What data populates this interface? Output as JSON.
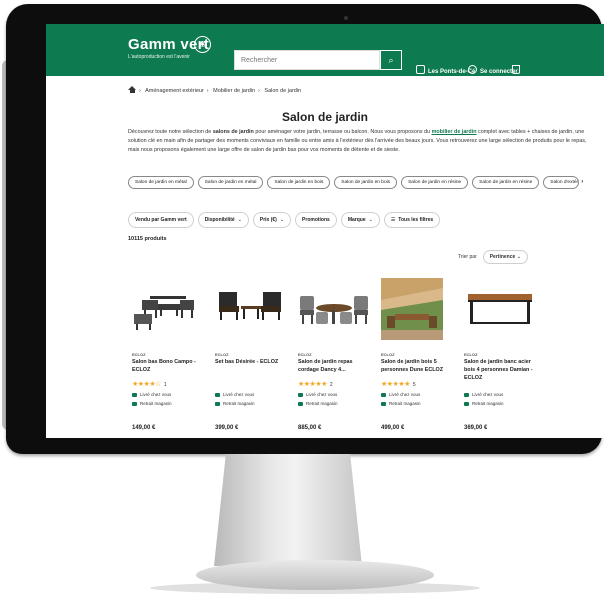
{
  "header": {
    "logo": "Gamm vert",
    "tagline": "L'autoproduction est l'avenir",
    "search_placeholder": "Rechercher",
    "store_label": "Les Ponts-de-Cé",
    "login_label": "Se connecter"
  },
  "breadcrumb": [
    "Aménagement extérieur",
    "Mobilier de jardin",
    "Salon de jardin"
  ],
  "page_title": "Salon de jardin",
  "intro": {
    "part1": "Découvrez toute notre sélection de ",
    "bold1": "salons de jardin",
    "part2": " pour aménager votre jardin, terrasse ou balcon. Nous vous proposons du ",
    "link": "mobilier de jardin",
    "part3": " complet avec tables + chaises de jardin, une solution clé en main afin de partager des moments conviviaux en famille ou entre amis à l'extérieur dès l'arrivée des beaux jours. Vous retrouverez une large sélection de produits pour le repas, mais nous proposons également une large offre de salon de jardin bas pour vos moments de détente et de sieste."
  },
  "category_chips": [
    "Salon de jardin en métal",
    "Salon de jardin en métal",
    "Salon de jardin en bois",
    "Salon de jardin en bois",
    "Salon de jardin en résine",
    "Salon de jardin en résine",
    "Salon d'extérieur"
  ],
  "filters": [
    {
      "label": "Vendu par Gamm vert",
      "dropdown": false
    },
    {
      "label": "Disponibilité",
      "dropdown": true
    },
    {
      "label": "Prix (€)",
      "dropdown": true
    },
    {
      "label": "Promotions",
      "dropdown": false
    },
    {
      "label": "Marque",
      "dropdown": true
    },
    {
      "label": "Tous les filtres",
      "dropdown": false
    }
  ],
  "product_count": "10115 produits",
  "sort": {
    "label": "Trier par",
    "value": "Pertinence"
  },
  "services": {
    "delivery": "Livré chez vous",
    "pickup": "Retrait magasin"
  },
  "products": [
    {
      "brand": "ECLOZ",
      "name": "Salon bas Bono Campo - ECLOZ",
      "stars": "★★★★☆",
      "reviews": "1",
      "price": "149,00 €"
    },
    {
      "brand": "ECLOZ",
      "name": "Set bas Désirée - ECLOZ",
      "stars": "",
      "reviews": "",
      "price": "399,00 €"
    },
    {
      "brand": "ECLOZ",
      "name": "Salon de jardin repas cordage Dancy 4...",
      "stars": "★★★★★",
      "reviews": "2",
      "price": "885,00 €"
    },
    {
      "brand": "ECLOZ",
      "name": "Salon de jardin bois 5 personnes Dune ECLOZ",
      "stars": "★★★★★",
      "reviews": "5",
      "price": "499,00 €"
    },
    {
      "brand": "ECLOZ",
      "name": "Salon de jardin banc acier bois 4 personnes Damian - ECLOZ",
      "stars": "",
      "reviews": "",
      "price": "369,00 €"
    }
  ],
  "colors": {
    "brand_green": "#0e7a4f",
    "star": "#f5a623"
  }
}
